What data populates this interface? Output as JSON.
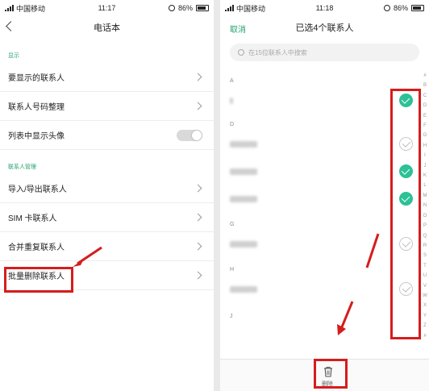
{
  "left": {
    "status": {
      "carrier": "中国移动",
      "time": "11:17",
      "battery": "86%",
      "battery_level": 0.86
    },
    "title": "电话本",
    "sections": [
      {
        "header": "显示",
        "items": [
          "要显示的联系人",
          "联系人号码整理",
          "列表中显示头像"
        ]
      },
      {
        "header": "联系人管理",
        "items": [
          "导入/导出联系人",
          "SIM 卡联系人",
          "合并重复联系人",
          "批量删除联系人"
        ]
      }
    ]
  },
  "right": {
    "status": {
      "carrier": "中国移动",
      "time": "11:18",
      "battery": "86%",
      "battery_level": 0.86
    },
    "cancel": "取消",
    "title": "已选4个联系人",
    "search_placeholder": "在15位联系人中搜索",
    "letters": [
      "A",
      "D",
      "G",
      "H",
      "J"
    ],
    "contacts": [
      {
        "checked": true
      },
      {
        "checked": false
      },
      {
        "checked": true
      },
      {
        "checked": true
      },
      {
        "checked": false
      },
      {
        "checked": false
      }
    ],
    "index": [
      "#",
      "B",
      "C",
      "D",
      "E",
      "F",
      "G",
      "H",
      "I",
      "J",
      "K",
      "L",
      "M",
      "N",
      "O",
      "P",
      "Q",
      "R",
      "S",
      "T",
      "U",
      "V",
      "W",
      "X",
      "Y",
      "Z",
      "#"
    ],
    "delete_label": "删除"
  },
  "colors": {
    "accent": "#21a06b",
    "check": "#2cc196",
    "highlight": "#d51d1d"
  }
}
